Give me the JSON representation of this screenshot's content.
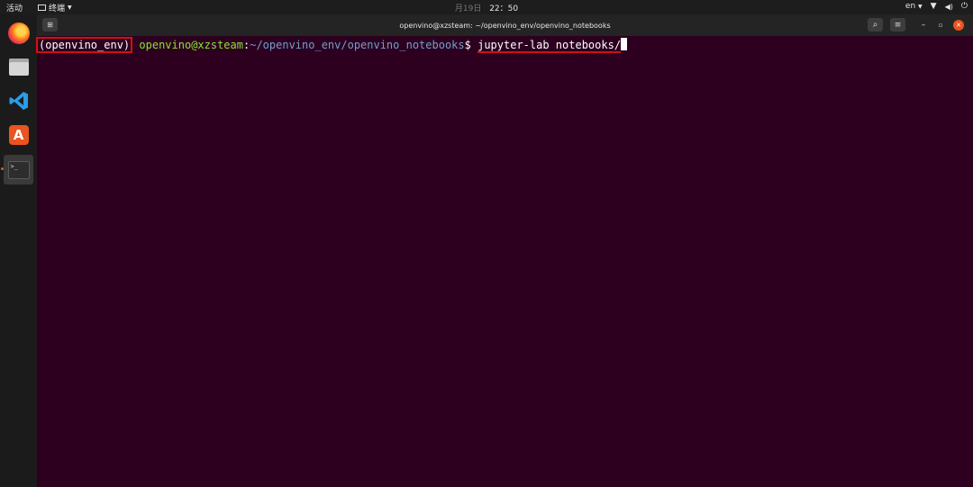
{
  "topbar": {
    "activities": "活动",
    "app_menu_label": "终端",
    "date_partial": "月19日",
    "time": "22：50",
    "language": "en"
  },
  "dock": {
    "items": [
      {
        "name": "firefox-icon"
      },
      {
        "name": "files-icon"
      },
      {
        "name": "vscode-icon"
      },
      {
        "name": "software-center-icon"
      },
      {
        "name": "terminal-icon"
      }
    ],
    "terminal_glyph": ">_"
  },
  "window": {
    "title": "openvino@xzsteam: ~/openvino_env/openvino_notebooks"
  },
  "terminal": {
    "venv": "(openvino_env)",
    "userhost": "openvino@xzsteam",
    "colon": ":",
    "path": "~/openvino_env/openvino_notebooks",
    "prompt_symbol": "$",
    "command": "jupyter-lab notebooks/"
  },
  "colors": {
    "terminal_bg": "#2c001e",
    "userhost": "#8ae234",
    "path": "#729fcf",
    "annotation_red": "#d01015",
    "accent": "#e95420"
  }
}
